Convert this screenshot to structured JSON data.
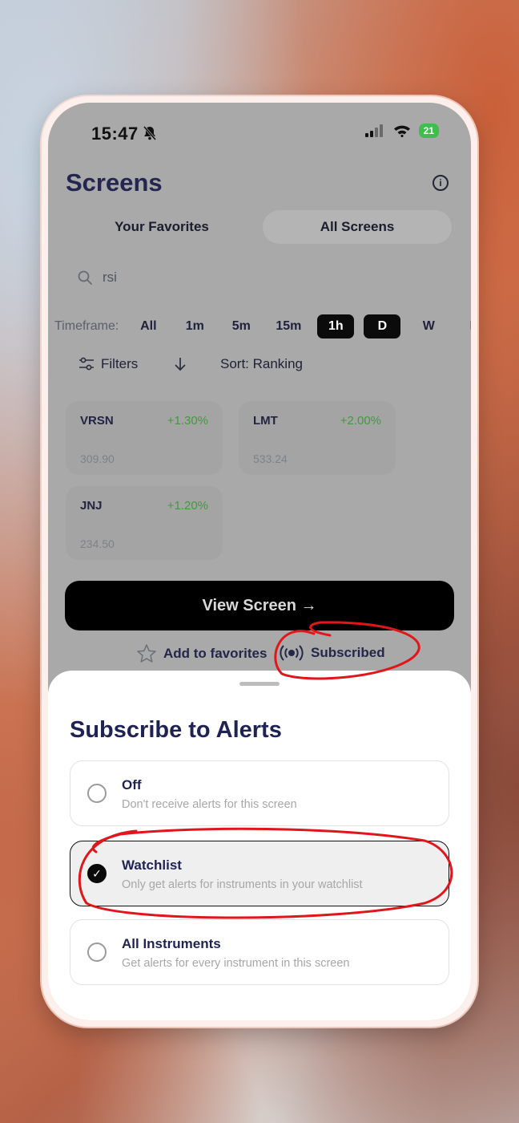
{
  "status_bar": {
    "time": "15:47",
    "battery": "21"
  },
  "header": {
    "title": "Screens",
    "info_icon": "info-icon"
  },
  "segments": [
    {
      "label": "Your Favorites",
      "active": false
    },
    {
      "label": "All Screens",
      "active": true
    }
  ],
  "search": {
    "value": "rsi",
    "icon": "search-icon"
  },
  "timeframe": {
    "label": "Timeframe:",
    "options": [
      {
        "label": "All",
        "selected": false
      },
      {
        "label": "1m",
        "selected": false
      },
      {
        "label": "5m",
        "selected": false
      },
      {
        "label": "15m",
        "selected": false
      },
      {
        "label": "1h",
        "selected": true
      },
      {
        "label": "D",
        "selected": true
      },
      {
        "label": "W",
        "selected": false
      },
      {
        "label": "M",
        "selected": false
      }
    ]
  },
  "toolbar": {
    "filters_label": "Filters",
    "sort_label": "Sort: Ranking"
  },
  "instruments": [
    {
      "symbol": "VRSN",
      "change": "+1.30%",
      "price": "309.90"
    },
    {
      "symbol": "LMT",
      "change": "+2.00%",
      "price": "533.24"
    },
    {
      "symbol": "JNJ",
      "change": "+1.20%",
      "price": "234.50"
    }
  ],
  "actions": {
    "view_screen": "View Screen →",
    "add_favorites": "Add to favorites",
    "subscribed": "Subscribed"
  },
  "sheet": {
    "title": "Subscribe to Alerts",
    "options": [
      {
        "label": "Off",
        "description": "Don't receive alerts for this screen",
        "selected": false
      },
      {
        "label": "Watchlist",
        "description": "Only get alerts for instruments in your watchlist",
        "selected": true
      },
      {
        "label": "All Instruments",
        "description": "Get alerts for every instrument in this screen",
        "selected": false
      }
    ]
  },
  "colors": {
    "accent_green": "#3f9c3c",
    "title_navy": "#1f2354",
    "annotation_red": "#e0161b",
    "battery_green": "#3fbf4a"
  }
}
